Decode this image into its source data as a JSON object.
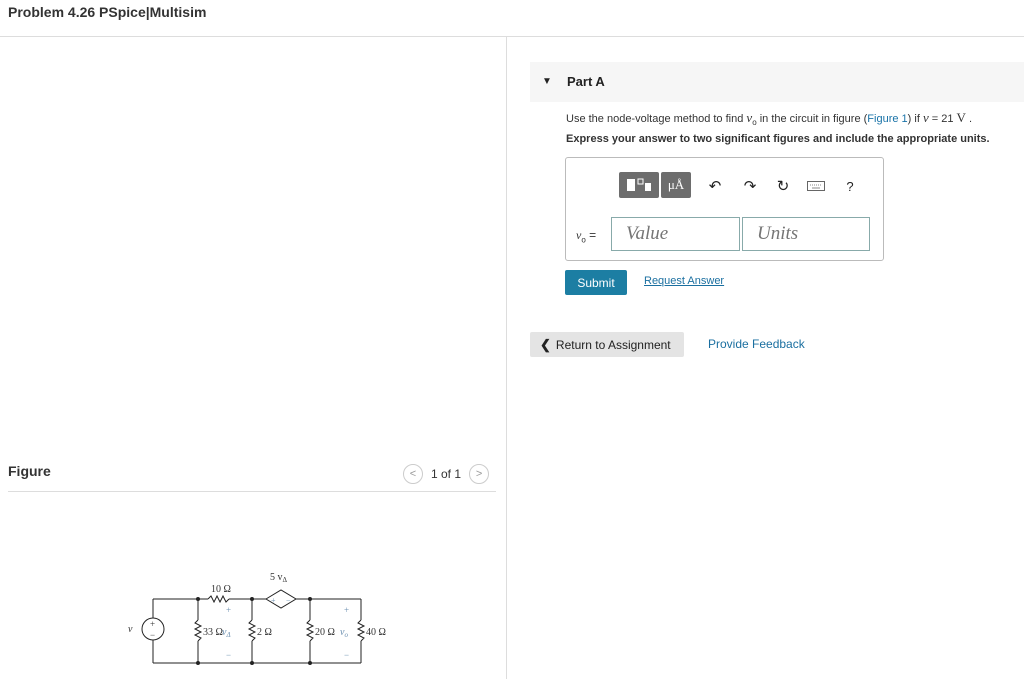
{
  "header": {
    "title": "Problem 4.26 PSpice|Multisim"
  },
  "figure_panel": {
    "label": "Figure",
    "pager": {
      "text": "1 of 1",
      "prev_icon": "chevron-left-icon",
      "next_icon": "chevron-right-icon"
    },
    "circuit": {
      "source_label": "v",
      "source_plus": "+",
      "source_minus": "−",
      "r10": "10 Ω",
      "r33": "33 Ω",
      "r2": "2 Ω",
      "r20": "20 Ω",
      "r40": "40 Ω",
      "dep_source": "5 v",
      "dep_source_sub": "Δ",
      "dep_plus": "+",
      "dep_minus": "−",
      "vdelta": "v",
      "vdelta_sub": "Δ",
      "vo": "v",
      "vo_sub": "o",
      "plus": "+",
      "minus": "−"
    }
  },
  "part_a": {
    "caret_icon": "caret-down-icon",
    "title": "Part A",
    "question": {
      "prefix": "Use the node-voltage method to find ",
      "var": "v",
      "var_sub": "o",
      "mid": " in the circuit in figure (",
      "link": "Figure 1",
      "mid2": ") if ",
      "var2": "v",
      "eq": " = 21 ",
      "unit": "V",
      "end": " ."
    },
    "instruction": "Express your answer to two significant figures and include the appropriate units.",
    "toolbar": {
      "templates_icon": "templates-icon",
      "units_label": "μÅ",
      "undo_icon": "undo-icon",
      "redo_icon": "redo-icon",
      "reset_icon": "reset-icon",
      "keyboard_icon": "keyboard-icon",
      "help_label": "?"
    },
    "answer_label": "v",
    "answer_label_sub": "o",
    "answer_eq": " =",
    "value_placeholder": "Value",
    "units_placeholder": "Units",
    "submit_label": "Submit",
    "request_label": "Request Answer"
  },
  "footer": {
    "return_label": "Return to Assignment",
    "feedback_label": "Provide Feedback"
  }
}
